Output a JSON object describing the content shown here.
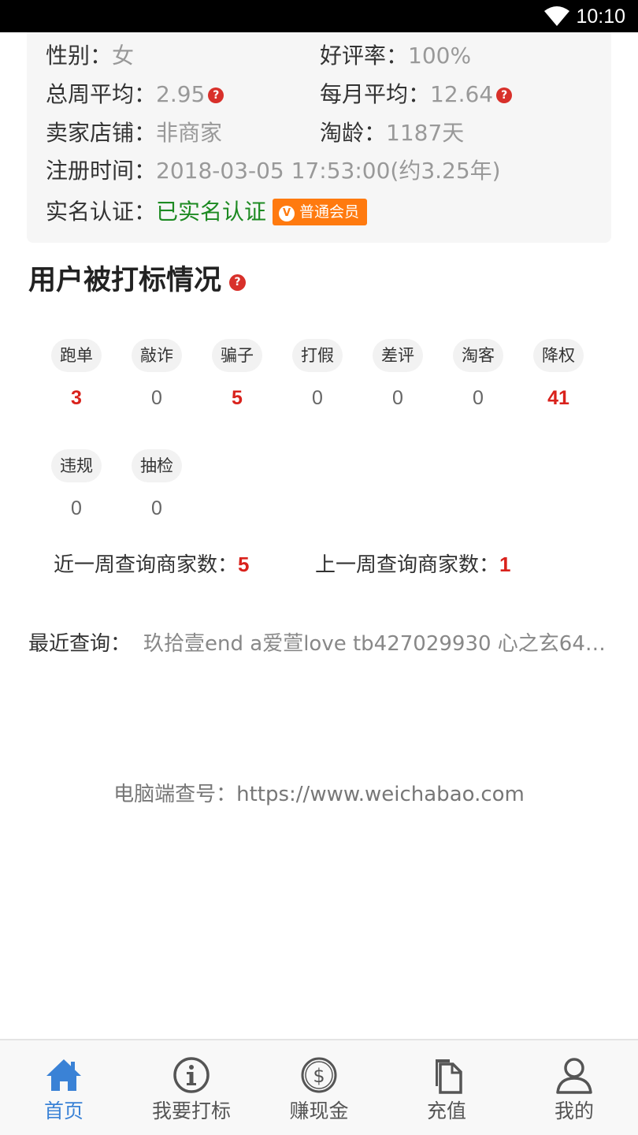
{
  "status_bar": {
    "time": "10:10"
  },
  "profile": {
    "gender_label": "性别：",
    "gender": "女",
    "rating_label": "好评率：",
    "rating": "100%",
    "weekly_avg_label": "总周平均：",
    "weekly_avg": "2.95",
    "monthly_avg_label": "每月平均：",
    "monthly_avg": "12.64",
    "shop_label": "卖家店铺：",
    "shop": "非商家",
    "age_label": "淘龄：",
    "age": "1187天",
    "reg_label": "注册时间：",
    "reg_time": "2018-03-05 17:53:00(约3.25年)",
    "verify_label": "实名认证：",
    "verify": "已实名认证",
    "member_badge": "普通会员",
    "member_badge_letter": "V",
    "help_glyph": "?"
  },
  "section": {
    "title": "用户被打标情况"
  },
  "tags": [
    {
      "label": "跑单",
      "count": "3",
      "highlight": true
    },
    {
      "label": "敲诈",
      "count": "0",
      "highlight": false
    },
    {
      "label": "骗子",
      "count": "5",
      "highlight": true
    },
    {
      "label": "打假",
      "count": "0",
      "highlight": false
    },
    {
      "label": "差评",
      "count": "0",
      "highlight": false
    },
    {
      "label": "淘客",
      "count": "0",
      "highlight": false
    },
    {
      "label": "降权",
      "count": "41",
      "highlight": true
    },
    {
      "label": "违规",
      "count": "0",
      "highlight": false
    },
    {
      "label": "抽检",
      "count": "0",
      "highlight": false
    }
  ],
  "weekly": {
    "this_week_label": "近一周查询商家数：",
    "this_week": "5",
    "last_week_label": "上一周查询商家数：",
    "last_week": "1"
  },
  "recent": {
    "label": "最近查询：",
    "value": "玖拾壹end a爱萱love tb427029930 心之玄64…"
  },
  "pc_site": "电脑端查号：https://www.weichabao.com",
  "tabbar": {
    "items": [
      {
        "label": "首页",
        "icon": "home-icon",
        "active": true
      },
      {
        "label": "我要打标",
        "icon": "info-icon",
        "active": false
      },
      {
        "label": "赚现金",
        "icon": "dollar-icon",
        "active": false
      },
      {
        "label": "充值",
        "icon": "documents-icon",
        "active": false
      },
      {
        "label": "我的",
        "icon": "user-icon",
        "active": false
      }
    ],
    "active_color": "#3a82d6",
    "inactive_color": "#555555"
  }
}
